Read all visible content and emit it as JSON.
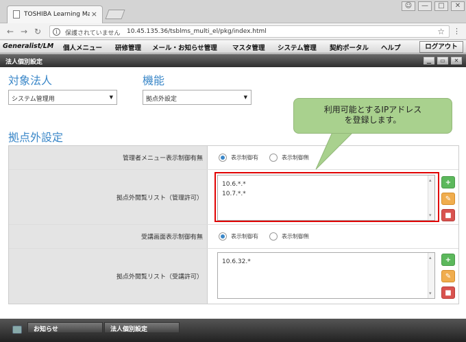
{
  "browser": {
    "tab_title": "TOSHIBA Learning Manage",
    "tab_close": "×",
    "security_text": "保護されていません",
    "url": "10.45.135.36/tsblms_multi_el/pkg/index.html",
    "user_icon": "person-icon",
    "minimize": "—",
    "maximize": "□",
    "close": "✕"
  },
  "menubar": {
    "brand": "Generalist/LM",
    "items": [
      "個人メニュー",
      "研修管理",
      "メール・お知らせ管理",
      "マスタ管理",
      "システム管理",
      "契約ポータル",
      "ヘルプ"
    ],
    "logout": "ログアウト"
  },
  "window": {
    "title": "法人個別設定"
  },
  "target_company": {
    "heading": "対象法人",
    "selected": "システム管理用"
  },
  "function": {
    "heading": "機能",
    "selected": "拠点外設定"
  },
  "section_heading": "拠点外設定",
  "callout": {
    "line1": "利用可能とするIPアドレス",
    "line2": "を登録します。"
  },
  "rows": [
    {
      "label": "管理者メニュー表示制御有無",
      "option_on": "表示制御有",
      "option_off": "表示制御無"
    },
    {
      "label": "拠点外閲覧リスト（管理許可）",
      "values": [
        "10.6.*.*",
        "10.7.*.*"
      ]
    },
    {
      "label": "受講画面表示制御有無",
      "option_on": "表示制御有",
      "option_off": "表示制御無"
    },
    {
      "label": "拠点外閲覧リスト（受講許可）",
      "values": [
        "10.6.32.*"
      ]
    }
  ],
  "footer": {
    "tabs": [
      "お知らせ",
      "法人個別設定"
    ]
  },
  "colors": {
    "accent": "#3a87c8",
    "add": "#5cb85c",
    "edit": "#f0ad4e",
    "delete": "#d9534f",
    "highlight": "#e00000",
    "callout": "#a9d18e"
  }
}
